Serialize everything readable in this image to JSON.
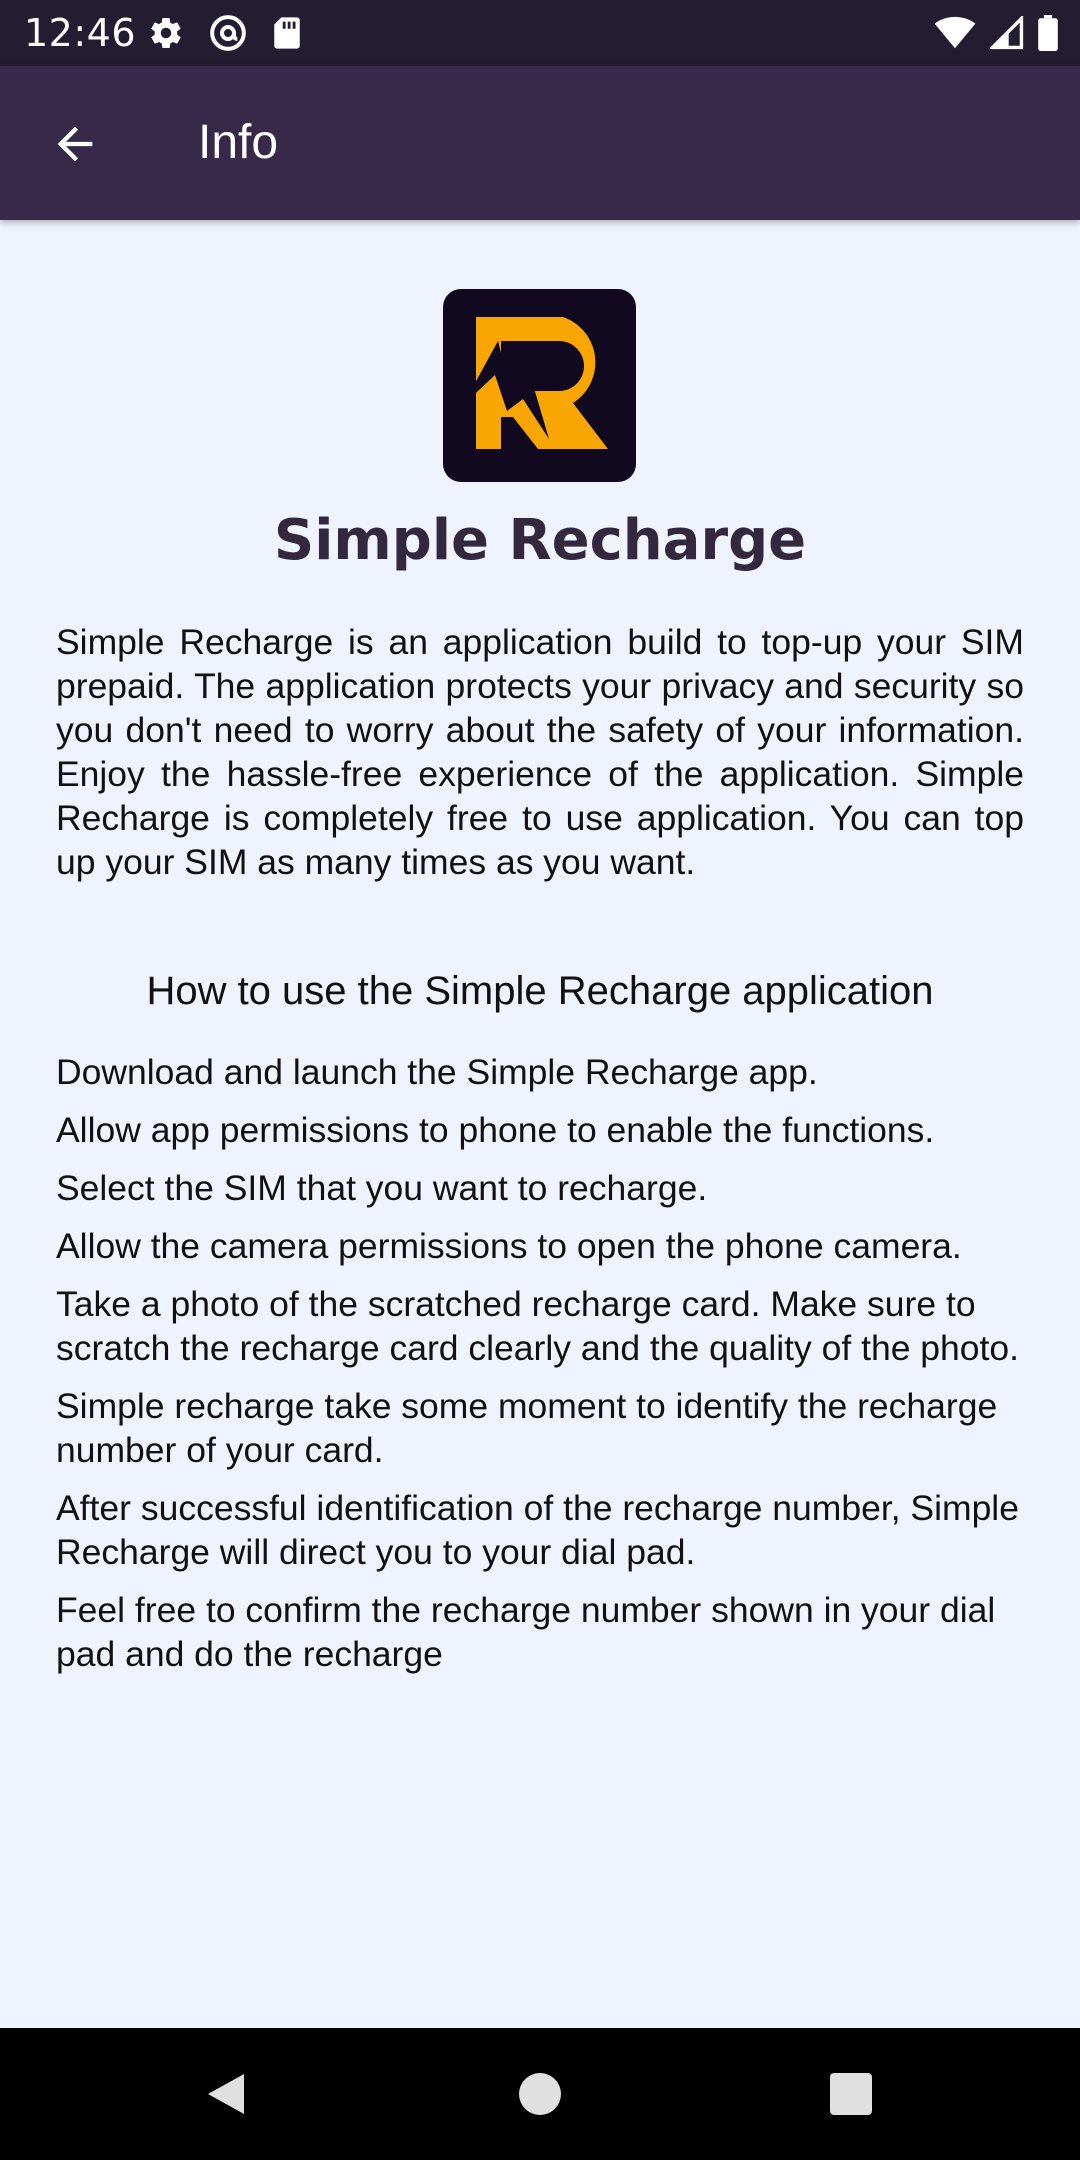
{
  "status_bar": {
    "time": "12:46",
    "icons_left": [
      "settings-gear-icon",
      "at-sign-icon",
      "sd-card-icon"
    ],
    "icons_right": [
      "wifi-icon",
      "cell-signal-icon",
      "battery-icon"
    ]
  },
  "app_bar": {
    "back_icon": "arrow-back-icon",
    "title": "Info"
  },
  "app": {
    "logo_icon": "simple-recharge-logo",
    "name": "Simple Recharge",
    "description": "Simple Recharge is an application build to top-up your SIM prepaid. The application protects your privacy and security so you don't need to worry about the safety of your information. Enjoy the hassle-free experience of the application. Simple Recharge is completely free to use application. You can top up your SIM as many times as you want."
  },
  "howto": {
    "heading": "How to use the Simple Recharge application",
    "steps": [
      "Download and launch the Simple Recharge app.",
      "Allow app permissions to phone to enable the functions.",
      "Select the SIM that you want to recharge.",
      "Allow the camera permissions to open the phone camera.",
      "Take a photo of the scratched recharge card. Make sure to scratch the recharge card clearly and the quality of the photo.",
      "Simple recharge take some moment to identify the recharge number of your card.",
      "After successful identification of the recharge number, Simple Recharge will direct you to your dial pad.",
      "Feel free to confirm the recharge number shown in your dial pad and do the recharge"
    ]
  },
  "nav_bar": {
    "icons": [
      "nav-back-icon",
      "nav-home-icon",
      "nav-recents-icon"
    ]
  },
  "colors": {
    "status_bar": "#241c31",
    "app_bar": "#372948",
    "background": "#eff3fd",
    "logo_background": "#100920",
    "logo_accent": "#f9a602",
    "title_text": "#34283f"
  }
}
